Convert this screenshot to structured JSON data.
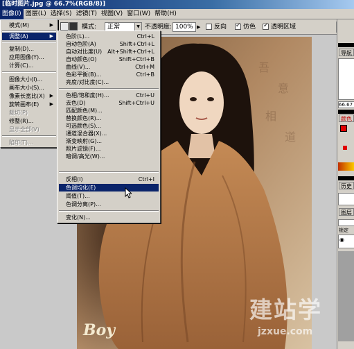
{
  "window": {
    "title": "[临时图片.jpg @ 66.7%(RGB/8)]"
  },
  "menubar": [
    "图像(I)",
    "图层(L)",
    "选择(S)",
    "滤镜(T)",
    "视图(V)",
    "窗口(W)",
    "帮助(H)"
  ],
  "options": {
    "mode_label": "模式:",
    "mode_value": "正常",
    "opacity_label": "不透明度:",
    "opacity_value": "100%",
    "reverse_label": "反向",
    "dither_label": "仿色",
    "transparency_label": "透明区域"
  },
  "image_menu": [
    {
      "label": "模式(M)",
      "submenu": true
    },
    {
      "sep": true
    },
    {
      "label": "调整(A)",
      "submenu": true,
      "highlight": true
    },
    {
      "sep": true
    },
    {
      "label": "复制(D)..."
    },
    {
      "label": "应用图像(Y)..."
    },
    {
      "label": "计算(C)..."
    },
    {
      "sep": true
    },
    {
      "label": "图像大小(I)..."
    },
    {
      "label": "画布大小(S)..."
    },
    {
      "label": "像素长宽比(X)",
      "submenu": true
    },
    {
      "label": "旋转画布(E)",
      "submenu": true
    },
    {
      "label": "裁切(P)",
      "disabled": true
    },
    {
      "label": "修整(R)..."
    },
    {
      "label": "显示全部(V)",
      "disabled": true
    },
    {
      "sep": true
    },
    {
      "label": "陷印(T)...",
      "disabled": true
    }
  ],
  "adjust_menu": [
    {
      "label": "色阶(L)...",
      "shortcut": "Ctrl+L"
    },
    {
      "label": "自动色阶(A)",
      "shortcut": "Shift+Ctrl+L"
    },
    {
      "label": "自动对比度(U)",
      "shortcut": "Alt+Shift+Ctrl+L"
    },
    {
      "label": "自动颜色(O)",
      "shortcut": "Shift+Ctrl+B"
    },
    {
      "label": "曲线(V)...",
      "shortcut": "Ctrl+M"
    },
    {
      "label": "色彩平衡(B)...",
      "shortcut": "Ctrl+B"
    },
    {
      "label": "亮度/对比度(C)..."
    },
    {
      "sep": true
    },
    {
      "label": "色相/饱和度(H)...",
      "shortcut": "Ctrl+U"
    },
    {
      "label": "去色(D)",
      "shortcut": "Shift+Ctrl+U"
    },
    {
      "label": "匹配颜色(M)..."
    },
    {
      "label": "替换颜色(R)..."
    },
    {
      "label": "可选颜色(S)..."
    },
    {
      "label": "通道混合器(X)..."
    },
    {
      "label": "渐变映射(G)..."
    },
    {
      "label": "照片滤镜(F)..."
    },
    {
      "label": "暗调/高光(W)..."
    },
    {
      "sep": true
    },
    {
      "label": "反相(I)",
      "shortcut": "Ctrl+I"
    },
    {
      "label": "色调均化(E)",
      "highlight": true
    },
    {
      "label": "阈值(T)..."
    },
    {
      "label": "色调分离(P)..."
    },
    {
      "sep": true
    },
    {
      "label": "变化(N)..."
    }
  ],
  "right_panel": {
    "tabs": [
      "导航",
      "颜色",
      "历史",
      "图层"
    ],
    "zoom_value": "66.67",
    "lock_label": "锁定"
  },
  "image_text": {
    "signature": "Boy"
  },
  "watermark": {
    "main": "建站学",
    "url": "jzxue.com"
  },
  "colors": {
    "menu_highlight": "#0a246a",
    "chrome": "#d4d0c8",
    "title_start": "#0a246a"
  }
}
